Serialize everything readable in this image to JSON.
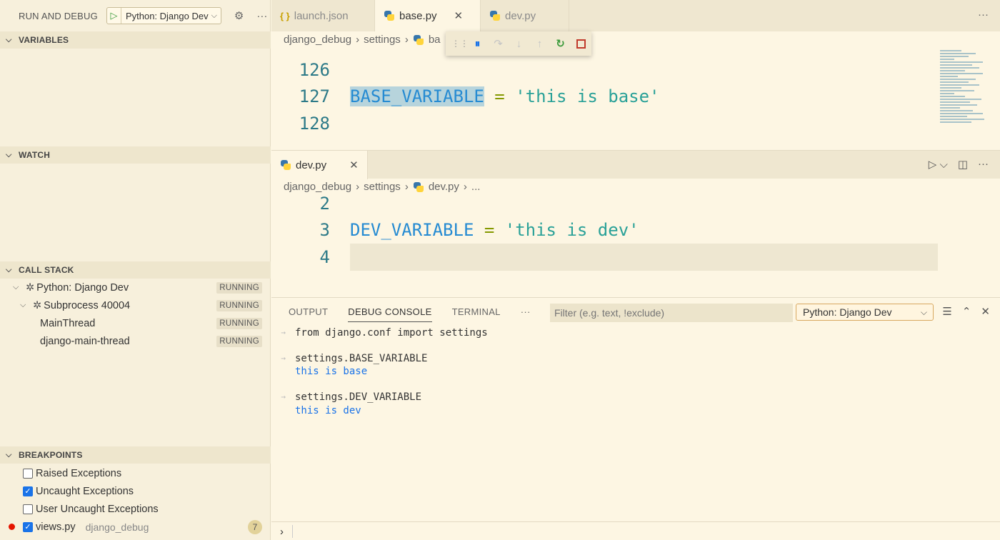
{
  "sidebar": {
    "title": "RUN AND DEBUG",
    "config_name": "Python: Django Dev",
    "sections": {
      "variables": "VARIABLES",
      "watch": "WATCH",
      "call_stack": "CALL STACK",
      "breakpoints": "BREAKPOINTS"
    },
    "call_stack": [
      {
        "label": "Python: Django Dev",
        "status": "RUNNING"
      },
      {
        "label": "Subprocess 40004",
        "status": "RUNNING"
      },
      {
        "label": "MainThread",
        "status": "RUNNING"
      },
      {
        "label": "django-main-thread",
        "status": "RUNNING"
      }
    ],
    "breakpoints": [
      {
        "label": "Raised Exceptions",
        "checked": false
      },
      {
        "label": "Uncaught Exceptions",
        "checked": true
      },
      {
        "label": "User Uncaught Exceptions",
        "checked": false
      },
      {
        "label": "views.py",
        "path": "django_debug",
        "checked": true,
        "count": "7"
      }
    ]
  },
  "tabs": [
    {
      "label": "launch.json",
      "icon": "json-icon",
      "active": false
    },
    {
      "label": "base.py",
      "icon": "python-icon",
      "active": true
    },
    {
      "label": "dev.py",
      "icon": "python-icon",
      "active": false
    }
  ],
  "top_editor": {
    "breadcrumb": [
      "django_debug",
      "settings",
      "ba"
    ],
    "lines": [
      {
        "n": "126",
        "ident": "",
        "op": "",
        "str": ""
      },
      {
        "n": "127",
        "ident": "BASE_VARIABLE",
        "op": " = ",
        "str": "'this is base'"
      },
      {
        "n": "128",
        "ident": "",
        "op": "",
        "str": ""
      }
    ]
  },
  "bottom_editor": {
    "tab_label": "dev.py",
    "breadcrumb": [
      "django_debug",
      "settings",
      "dev.py",
      "..."
    ],
    "lines": [
      {
        "n": "2",
        "ident": "",
        "op": "",
        "str": ""
      },
      {
        "n": "3",
        "ident": "DEV_VARIABLE",
        "op": " = ",
        "str": "'this is dev'"
      },
      {
        "n": "4",
        "ident": "",
        "op": "",
        "str": ""
      }
    ]
  },
  "panel": {
    "tabs": [
      "OUTPUT",
      "DEBUG CONSOLE",
      "TERMINAL"
    ],
    "active_tab": "DEBUG CONSOLE",
    "filter_placeholder": "Filter (e.g. text, !exclude)",
    "session": "Python: Django Dev",
    "console": [
      {
        "type": "in",
        "text": "from django.conf import settings"
      },
      {
        "type": "in",
        "text": "settings.BASE_VARIABLE"
      },
      {
        "type": "out",
        "text": "this is base"
      },
      {
        "type": "in",
        "text": "settings.DEV_VARIABLE"
      },
      {
        "type": "out",
        "text": "this is dev"
      }
    ]
  },
  "colors": {
    "background": "#fdf6e3",
    "sidebar": "#f7f0dc",
    "accent": "#1a73e8",
    "string": "#2aa198",
    "identifier": "#268bd2",
    "breakpoint": "#e51400"
  }
}
